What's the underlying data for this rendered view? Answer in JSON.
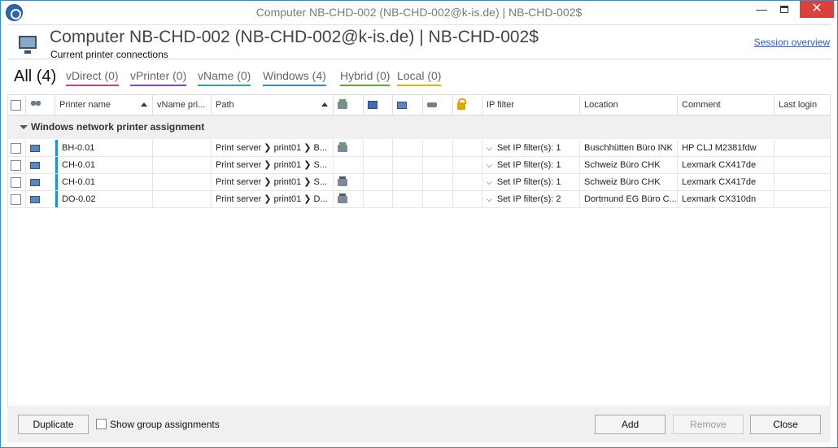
{
  "window": {
    "title": "Computer NB-CHD-002 (NB-CHD-002@k-is.de) | NB-CHD-002$",
    "minimize_glyph": "—",
    "close_glyph": "✕"
  },
  "header": {
    "title": "Computer NB-CHD-002 (NB-CHD-002@k-is.de) | NB-CHD-002$",
    "subtitle": "Current printer connections",
    "session_link": "Session overview"
  },
  "tabs": {
    "all": "All (4)",
    "vdirect": "vDirect (0)",
    "vprinter": "vPrinter (0)",
    "vname": "vName (0)",
    "windows": "Windows (4)",
    "hybrid": "Hybrid (0)",
    "local": "Local (0)"
  },
  "tab_colors": {
    "vdirect": "#e0358a",
    "vprinter": "#8a3fd1",
    "vname": "#2aa5a5",
    "windows": "#2a8fd6",
    "hybrid": "#5aa83c",
    "local": "#e0b400"
  },
  "columns": {
    "printer_name": "Printer name",
    "vname_printer": "vName pri...",
    "path": "Path",
    "ip_filter": "IP filter",
    "location": "Location",
    "comment": "Comment",
    "last_login": "Last login"
  },
  "group": {
    "label": "Windows network printer assignment"
  },
  "rows": [
    {
      "name": "BH-0.01",
      "path": "Print server ❯ print01 ❯ B...",
      "ip_filter": "Set IP filter(s): 1",
      "location": "Buschhütten Büro INK",
      "comment": "HP CLJ M2381fdw",
      "printer_icon": "green",
      "bold_location": true
    },
    {
      "name": "CH-0.01",
      "path": "Print server ❯ print01 ❯ S...",
      "ip_filter": "Set IP filter(s): 1",
      "location": "Schweiz Büro CHK",
      "comment": "Lexmark CX417de",
      "printer_icon": "",
      "bold_location": false
    },
    {
      "name": "CH-0.01",
      "path": "Print server ❯ print01 ❯ S...",
      "ip_filter": "Set IP filter(s): 1",
      "location": "Schweiz Büro CHK",
      "comment": "Lexmark CX417de",
      "printer_icon": "dark",
      "bold_location": false
    },
    {
      "name": "DO-0.02",
      "path": "Print server ❯ print01 ❯ D...",
      "ip_filter": "Set IP filter(s): 2",
      "location": "Dortmund EG Büro C...",
      "comment": "Lexmark CX310dn",
      "printer_icon": "dark",
      "bold_location": false
    }
  ],
  "path_prefix": "❯",
  "ip_chevron": "⌵",
  "footer": {
    "duplicate": "Duplicate",
    "show_group": "Show group assignments",
    "add": "Add",
    "remove": "Remove",
    "close": "Close"
  }
}
